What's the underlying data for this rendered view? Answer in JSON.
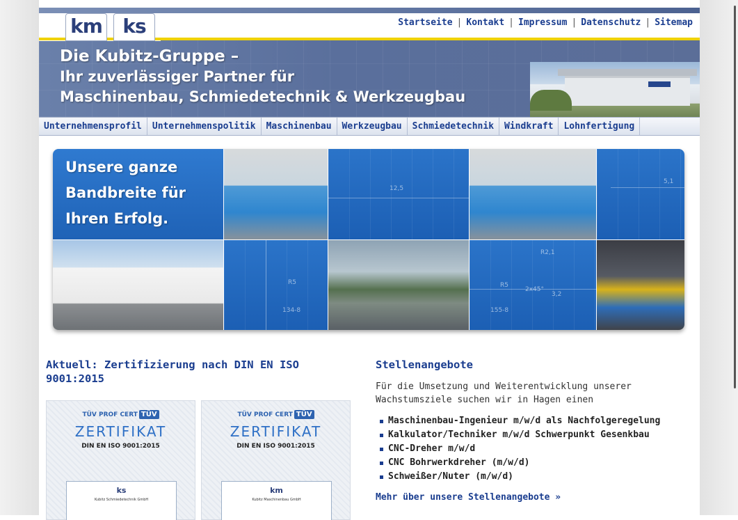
{
  "header": {
    "logo_km": "km",
    "logo_ks": "ks",
    "headline_line1": "Die Kubitz-Gruppe –",
    "headline_line2": "Ihr zuverlässiger Partner für",
    "headline_line3": "Maschinenbau, Schmiedetechnik & Werkzeugbau"
  },
  "top_nav": [
    "Startseite",
    "Kontakt",
    "Impressum",
    "Datenschutz",
    "Sitemap"
  ],
  "main_nav": [
    "Unternehmensprofil",
    "Unternehmenspolitik",
    "Maschinenbau",
    "Werkzeugbau",
    "Schmiedetechnik",
    "Windkraft",
    "Lohnfertigung"
  ],
  "banner": {
    "line1": "Unsere ganze",
    "line2": "Bandbreite für",
    "line3": "Ihren Erfolg.",
    "dims": [
      "12,5",
      "R2,1",
      "R5",
      "155-8",
      "2x45°",
      "3,2",
      "134-8",
      "5,1"
    ]
  },
  "news": {
    "title": "Aktuell: Zertifizierung nach DIN EN ISO 9001:2015",
    "certificates": [
      {
        "tuv_label": "TÜV PROF CERT",
        "tuv_badge": "TÜV",
        "heading": "ZERTIFIKAT",
        "standard": "DIN EN ISO 9001:2015",
        "logo": "ks",
        "company": "Kubitz Schmiedetechnik GmbH"
      },
      {
        "tuv_label": "TÜV PROF CERT",
        "tuv_badge": "TÜV",
        "heading": "ZERTIFIKAT",
        "standard": "DIN EN ISO 9001:2015",
        "logo": "km",
        "company": "Kubitz Maschinenbau GmbH"
      }
    ]
  },
  "jobs": {
    "title": "Stellenangebote",
    "intro": "Für die Umsetzung und Weiterentwicklung unserer Wachstumsziele suchen wir in Hagen einen",
    "items": [
      "Maschinenbau-Ingenieur m/w/d als Nachfolgeregelung",
      "Kalkulator/Techniker m/w/d Schwerpunkt Gesenkbau",
      "CNC-Dreher m/w/d",
      "CNC Bohrwerkdreher (m/w/d)",
      "Schweißer/Nuter (m/w/d)"
    ],
    "more_link": "Mehr über unsere Stellenangebote »"
  },
  "colors": {
    "link_blue": "#1a3d8f",
    "accent_yellow": "#f0d200",
    "banner_blue": "#2b74c9"
  }
}
